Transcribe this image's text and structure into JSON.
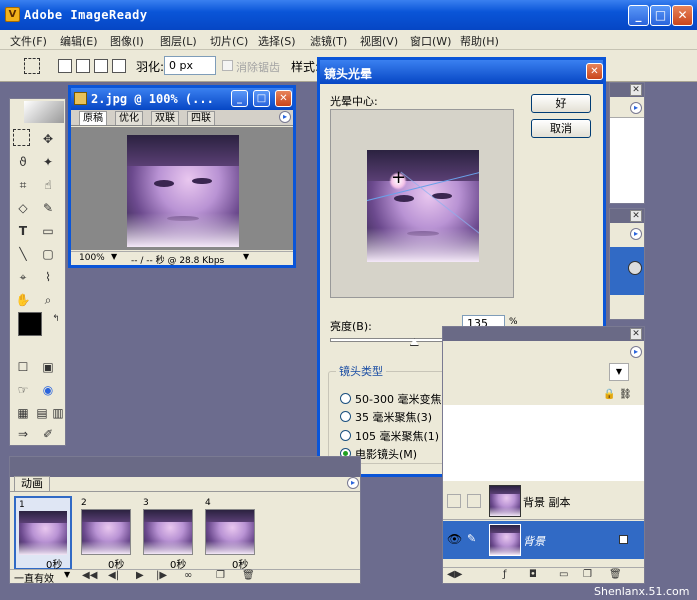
{
  "app": {
    "title": "Adobe ImageReady"
  },
  "menu": [
    "文件(F)",
    "编辑(E)",
    "图像(I)",
    "图层(L)",
    "切片(C)",
    "选择(S)",
    "滤镜(T)",
    "视图(V)",
    "窗口(W)",
    "帮助(H)"
  ],
  "options": {
    "feather_label": "羽化:",
    "feather_value": "0 px",
    "antialias_label": "消除锯齿",
    "style_label": "样式:"
  },
  "document": {
    "title": "2.jpg @ 100% (...",
    "tabs": [
      "原稿",
      "优化",
      "双联",
      "四联"
    ],
    "zoom": "100%",
    "status": "-- / -- 秒 @ 28.8 Kbps"
  },
  "dialog": {
    "title": "镜头光晕",
    "center_label": "光晕中心:",
    "ok": "好",
    "cancel": "取消",
    "brightness_label": "亮度(B):",
    "brightness_value": "135",
    "brightness_unit": "%",
    "brightness_fraction": 0.45,
    "lens_type_label": "镜头类型",
    "lens_types": [
      "50-300 毫米变焦(Z)",
      "35 毫米聚焦(3)",
      "105 毫米聚焦(1)",
      "电影镜头(M)"
    ],
    "selected_lens": 3
  },
  "animation": {
    "tab": "动画",
    "frames": [
      {
        "num": "1",
        "delay": "0秒"
      },
      {
        "num": "2",
        "delay": "0秒"
      },
      {
        "num": "3",
        "delay": "0秒"
      },
      {
        "num": "4",
        "delay": "0秒"
      }
    ],
    "loop": "一直有效"
  },
  "layers": {
    "items": [
      {
        "name": "背景 副本",
        "selected": false
      },
      {
        "name": "背景",
        "selected": true
      }
    ]
  },
  "watermark": "Shenlanx.51.com"
}
